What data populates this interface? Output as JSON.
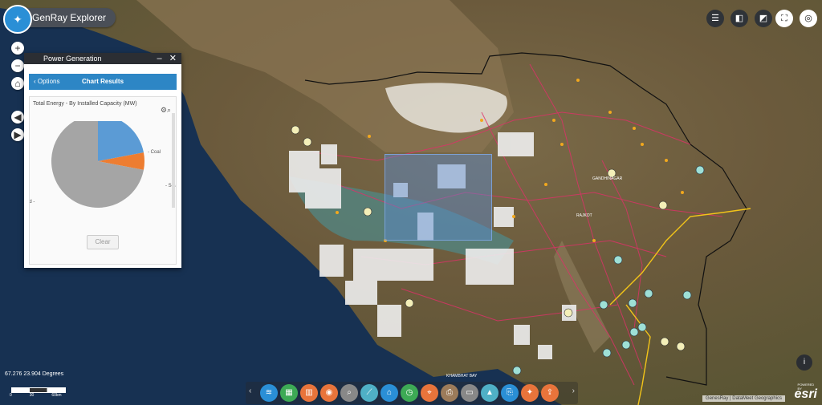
{
  "app": {
    "title": "GenRay Explorer",
    "logo_icon": "compass-icon"
  },
  "map_controls": {
    "zoom_in": "+",
    "zoom_out": "−",
    "home_icon": "home-icon",
    "back_icon": "arrow-left-icon",
    "forward_icon": "arrow-right-icon"
  },
  "top_right_tools": [
    "list-icon",
    "basemap-icon",
    "layers-icon",
    "fullscreen-icon",
    "visibility-toggle-icon"
  ],
  "panel": {
    "title": "Power Generation",
    "minimize": "–",
    "close": "✕",
    "options_label": "Options",
    "results_label": "Chart Results",
    "clear_label": "Clear"
  },
  "chart_data": {
    "type": "pie",
    "title": "Total Energy - By Installed Capacity (MW)",
    "slices": [
      {
        "label": "Coal",
        "value": 22,
        "color": "#5b9bd5"
      },
      {
        "label": "Solar",
        "value": 6,
        "color": "#ed7d31"
      },
      {
        "label": "Wind",
        "value": 72,
        "color": "#a5a5a5"
      }
    ]
  },
  "map_labels": {
    "gandhinagar": "GANDHINAGAR",
    "rajkot": "RAJKOT",
    "bay": "KHAMBHAT BAY"
  },
  "status": {
    "coordinates": "67.276 23.904 Degrees",
    "scale_labels": [
      "0",
      "30",
      "60km"
    ]
  },
  "attribution": "GenesRay | DataMeet Geographics",
  "esri_powered": "POWERED BY",
  "esri_logo": "esri",
  "info_icon": "info-icon",
  "bottom_toolbar": [
    {
      "name": "layers-tool",
      "color": "#2a8fd6",
      "glyph": "≋"
    },
    {
      "name": "grid-tool",
      "color": "#3daa55",
      "glyph": "▦"
    },
    {
      "name": "chart-tool",
      "color": "#e8743b",
      "glyph": "▥"
    },
    {
      "name": "identify-tool",
      "color": "#e8743b",
      "glyph": "◉"
    },
    {
      "name": "search-tool",
      "color": "#888888",
      "glyph": "⌕"
    },
    {
      "name": "measure-tool",
      "color": "#4fb0c6",
      "glyph": "⟋"
    },
    {
      "name": "station-tool",
      "color": "#2a8fd6",
      "glyph": "⌂"
    },
    {
      "name": "time-tool",
      "color": "#3daa55",
      "glyph": "◷"
    },
    {
      "name": "location-tool",
      "color": "#e8743b",
      "glyph": "⌖"
    },
    {
      "name": "print-preview-tool",
      "color": "#9c7b5a",
      "glyph": "⎙"
    },
    {
      "name": "print-tool",
      "color": "#888888",
      "glyph": "▭"
    },
    {
      "name": "elevation-tool",
      "color": "#4fb0c6",
      "glyph": "▲"
    },
    {
      "name": "printer-tool",
      "color": "#2a8fd6",
      "glyph": "⎘"
    },
    {
      "name": "bookmark-tool",
      "color": "#e8743b",
      "glyph": "✦"
    },
    {
      "name": "export-tool",
      "color": "#e8743b",
      "glyph": "⇪"
    }
  ]
}
